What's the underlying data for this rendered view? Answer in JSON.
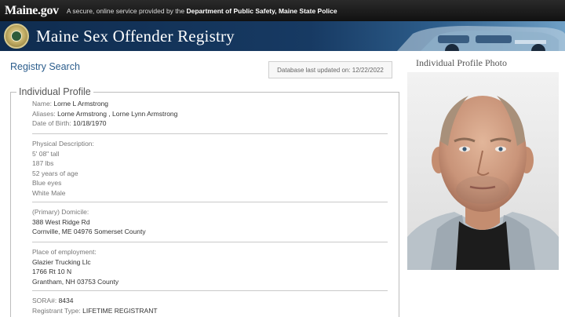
{
  "topbar": {
    "logo": "Maine.gov",
    "secure_prefix": "A secure, online service provided by the",
    "secure_org": "Department of Public Safety, Maine State Police"
  },
  "banner": {
    "title": "Maine Sex Offender Registry"
  },
  "search": {
    "link": "Registry Search",
    "db_updated": "Database last updated on: 12/22/2022"
  },
  "profile": {
    "legend": "Individual Profile",
    "name_label": "Name:",
    "name": "Lorne L Armstrong",
    "aliases_label": "Aliases:",
    "aliases": "Lorne Armstrong , Lorne Lynn Armstrong",
    "dob_label": "Date of Birth:",
    "dob": "10/18/1970",
    "physical_label": "Physical Description:",
    "height": "5' 08\" tall",
    "weight": "187 lbs",
    "age": "52 years of age",
    "eyes": "Blue eyes",
    "race": "White Male",
    "domicile_label": "(Primary) Domicile:",
    "domicile_street": "388 West Ridge Rd",
    "domicile_city": "Cornville, ME 04976 Somerset County",
    "employment_label": "Place of employment:",
    "employer": "Glazier Trucking Llc",
    "employer_street": "1766 Rt 10 N",
    "employer_city": "Grantham, NH 03753 County",
    "sora_label": "SORA#:",
    "sora": "8434",
    "type_label": "Registrant Type:",
    "type": "LIFETIME REGISTRANT"
  },
  "photo": {
    "title": "Individual Profile Photo"
  }
}
